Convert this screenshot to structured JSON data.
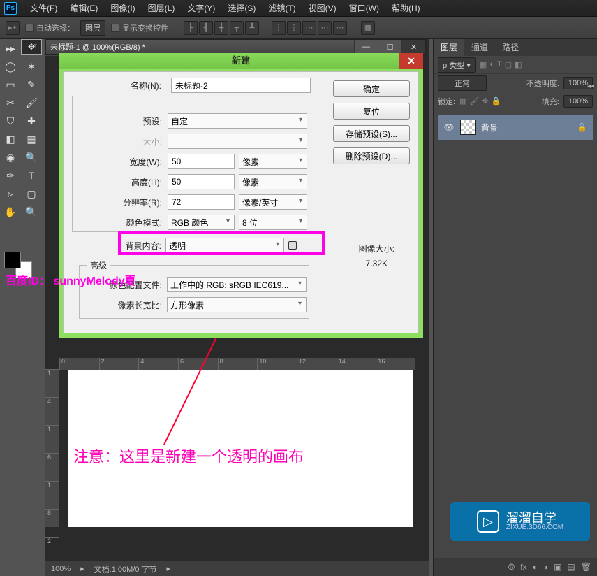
{
  "app": {
    "logo": "Ps"
  },
  "menu": [
    "文件(F)",
    "编辑(E)",
    "图像(I)",
    "图层(L)",
    "文字(Y)",
    "选择(S)",
    "滤镜(T)",
    "视图(V)",
    "窗口(W)",
    "帮助(H)"
  ],
  "options": {
    "auto_select": "自动选择：",
    "group": "图层",
    "show_transform": "显示变换控件"
  },
  "doc_tab": "未标题-1 @ 100%(RGB/8) *",
  "dialog": {
    "title": "新建",
    "name_label": "名称(N):",
    "name_value": "未标题-2",
    "preset_label": "预设:",
    "preset_value": "自定",
    "size_label": "大小:",
    "width_label": "宽度(W):",
    "width_value": "50",
    "width_unit": "像素",
    "height_label": "高度(H):",
    "height_value": "50",
    "height_unit": "像素",
    "res_label": "分辨率(R):",
    "res_value": "72",
    "res_unit": "像素/英寸",
    "mode_label": "颜色模式:",
    "mode_value": "RGB 颜色",
    "depth_value": "8 位",
    "bg_label": "背景内容:",
    "bg_value": "透明",
    "imgsize_label": "图像大小:",
    "imgsize_value": "7.32K",
    "adv": "高级",
    "profile_label": "颜色配置文件:",
    "profile_value": "工作中的 RGB: sRGB IEC619...",
    "aspect_label": "像素长宽比:",
    "aspect_value": "方形像素",
    "ok": "确定",
    "reset": "复位",
    "save_preset": "存储预设(S)...",
    "del_preset": "删除预设(D)..."
  },
  "status": {
    "zoom": "100%",
    "doc": "文档:1.00M/0 字节"
  },
  "layers": {
    "tabs": [
      "图层",
      "通道",
      "路径"
    ],
    "kind": "类型",
    "mode": "正常",
    "opacity_label": "不透明度:",
    "opacity": "100%",
    "lock": "锁定:",
    "fill_label": "填充:",
    "fill": "100%",
    "layer_name": "背景"
  },
  "note": "注意：这里是新建一个透明的画布",
  "baidu": "百度ID：\nsunnyMelody夏",
  "watermark": {
    "name": "溜溜自学",
    "site": "ZIXUE.3D66.COM"
  }
}
